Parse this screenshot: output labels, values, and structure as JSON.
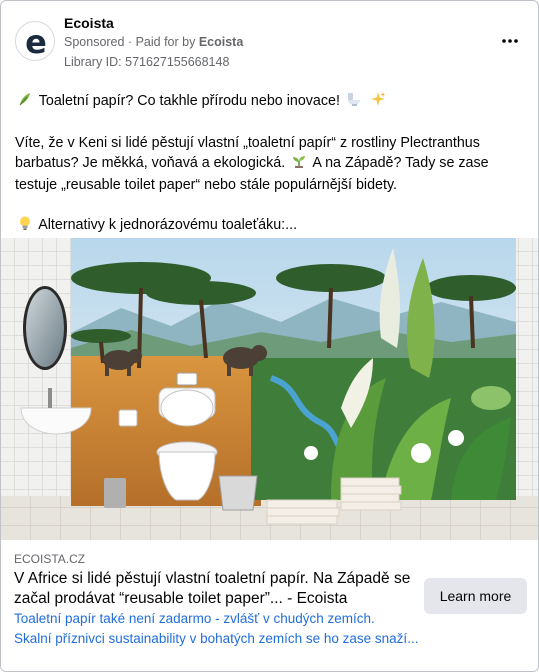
{
  "ad": {
    "page_name": "Ecoista",
    "sponsored": "Sponsored",
    "paid_for_prefix": "· Paid for by",
    "paid_for_name": "Ecoista",
    "library_id": "Library ID: 571627155668148",
    "avatar_letter": "e"
  },
  "post": {
    "line1": "Toaletní papír? Co takhle přírodu nebo inovace!",
    "para2_a": "Víte, že v Keni si lidé pěstují vlastní „toaletní papír“ z rostliny Plectranthus barbatus? Je měkká, voňavá a ekologická.",
    "para2_b": "A na Západě? Tady se zase testuje „reusable toilet paper“ nebo stále populárnější bidety.",
    "line3": "Alternativy k jednorázovému toaleťáku:..."
  },
  "link": {
    "domain": "ECOISTA.CZ",
    "headline": "V Africe si lidé pěstují vlastní toaletní papír. Na Západě se začal prodávat “reusable toilet paper”... - Ecoista",
    "desc1": "Toaletní papír také není zadarmo - zvlášť v chudých zemích.",
    "desc2": "Skalní příznivci sustainability v bohatých zemích se ho zase snaží...",
    "cta_label": "Learn more"
  },
  "icons": {
    "leaf": "leaf-icon",
    "toilet": "toilet-icon",
    "sparkles": "sparkles-icon",
    "seedling": "seedling-icon",
    "bulb": "lightbulb-icon",
    "more": "more-dots-icon"
  },
  "colors": {
    "link_blue": "#216fdb",
    "muted": "#65676b",
    "button_bg": "#e4e6eb",
    "brand_navy": "#1b2a3f"
  }
}
